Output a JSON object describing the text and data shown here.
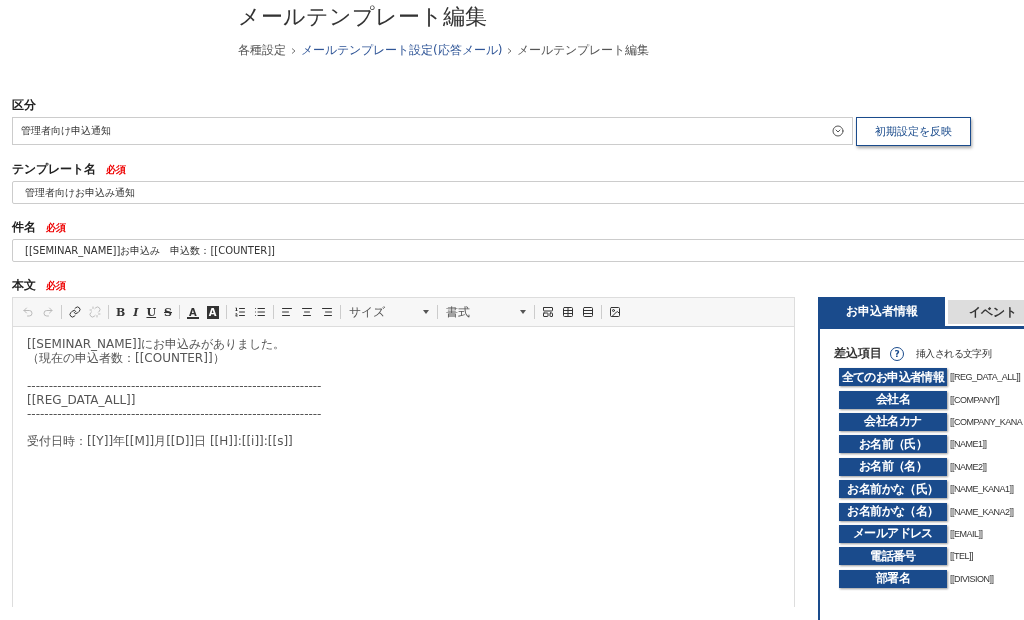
{
  "page_title": "メールテンプレート編集",
  "breadcrumb": [
    {
      "label": "各種設定",
      "link": false
    },
    {
      "label": "メールテンプレート設定(応答メール)",
      "link": true
    },
    {
      "label": "メールテンプレート編集",
      "link": false
    }
  ],
  "category": {
    "label": "区分",
    "value": "管理者向け申込通知",
    "button": "初期設定を反映"
  },
  "template_name": {
    "label": "テンプレート名",
    "required": "必須",
    "value": "管理者向けお申込み通知"
  },
  "subject": {
    "label": "件名",
    "required": "必須",
    "value": "[[SEMINAR_NAME]]お申込み　申込数：[[COUNTER]]"
  },
  "body": {
    "label": "本文",
    "required": "必須",
    "toolbar": [
      {
        "kind": "undo",
        "disabled": true
      },
      {
        "kind": "redo",
        "disabled": true
      },
      {
        "kind": "separator"
      },
      {
        "kind": "link",
        "disabled": false
      },
      {
        "kind": "unlink",
        "disabled": true
      },
      {
        "kind": "separator"
      },
      {
        "kind": "bold",
        "label": "B"
      },
      {
        "kind": "italic",
        "label": "I"
      },
      {
        "kind": "underline",
        "label": "U"
      },
      {
        "kind": "strike",
        "label": "S"
      },
      {
        "kind": "separator"
      },
      {
        "kind": "text-color",
        "label": "A"
      },
      {
        "kind": "bg-color",
        "label": "A"
      },
      {
        "kind": "separator"
      },
      {
        "kind": "ordered-list",
        "disabled": false
      },
      {
        "kind": "bullet-list",
        "disabled": false
      },
      {
        "kind": "separator"
      },
      {
        "kind": "align-left",
        "disabled": false
      },
      {
        "kind": "align-center",
        "disabled": false
      },
      {
        "kind": "align-right",
        "disabled": false
      },
      {
        "kind": "separator"
      },
      {
        "kind": "dropdown",
        "label": "サイズ"
      },
      {
        "kind": "separator"
      },
      {
        "kind": "dropdown",
        "label": "書式"
      },
      {
        "kind": "separator"
      },
      {
        "kind": "template",
        "disabled": false
      },
      {
        "kind": "table",
        "disabled": false
      },
      {
        "kind": "rule",
        "disabled": false
      },
      {
        "kind": "separator"
      },
      {
        "kind": "image",
        "disabled": false
      }
    ],
    "paragraphs": [
      [
        "[[SEMINAR_NAME]]にお申込みがありました。",
        "（現在の申込者数：[[COUNTER]]）"
      ],
      [
        "--------------------------------------------------------------------",
        "[[REG_DATA_ALL]]",
        "--------------------------------------------------------------------"
      ],
      [
        "受付日時：[[Y]]年[[M]]月[[D]]日 [[H]]:[[i]]:[[s]]"
      ]
    ]
  },
  "tabs": [
    {
      "label": "お申込者情報",
      "selected": true
    },
    {
      "label": "イベント",
      "selected": false
    }
  ],
  "insert_panel": {
    "heading": "差込項目",
    "help": "?",
    "column_2": "挿入される文字列",
    "items": [
      {
        "button": "全てのお申込者情報",
        "tag": "[[REG_DATA_ALL]]"
      },
      {
        "button": "会社名",
        "tag": "[[COMPANY]]"
      },
      {
        "button": "会社名カナ",
        "tag": "[[COMPANY_KANA"
      },
      {
        "button": "お名前（氏）",
        "tag": "[[NAME1]]"
      },
      {
        "button": "お名前（名）",
        "tag": "[[NAME2]]"
      },
      {
        "button": "お名前かな（氏）",
        "tag": "[[NAME_KANA1]]"
      },
      {
        "button": "お名前かな（名）",
        "tag": "[[NAME_KANA2]]"
      },
      {
        "button": "メールアドレス",
        "tag": "[[EMAIL]]"
      },
      {
        "button": "電話番号",
        "tag": "[[TEL]]"
      },
      {
        "button": "部署名",
        "tag": "[[DIVISION]]"
      }
    ]
  }
}
